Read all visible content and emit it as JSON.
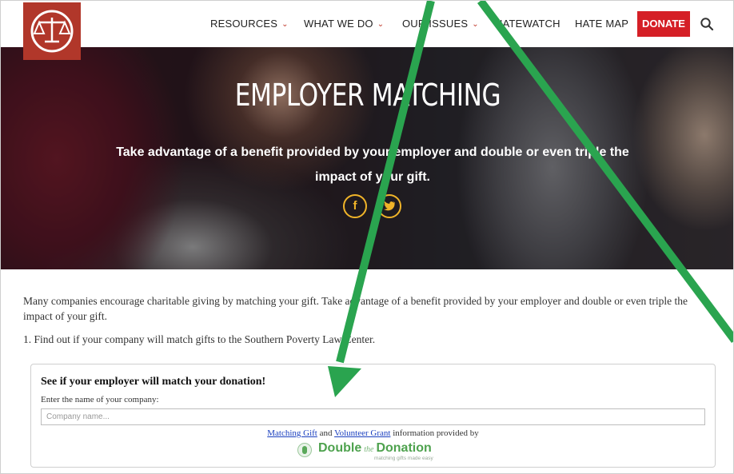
{
  "header": {
    "nav": [
      {
        "label": "RESOURCES",
        "has_dropdown": true
      },
      {
        "label": "WHAT WE DO",
        "has_dropdown": true
      },
      {
        "label": "OUR ISSUES",
        "has_dropdown": true
      },
      {
        "label": "HATEWATCH",
        "has_dropdown": false
      },
      {
        "label": "HATE MAP",
        "has_dropdown": false
      }
    ],
    "donate_label": "DONATE",
    "search_icon": "search-icon",
    "logo_icon": "scales-of-justice-icon"
  },
  "hero": {
    "title": "EMPLOYER MATCHING",
    "subtitle": "Take advantage of a benefit provided by your employer and double or even triple the impact of your gift.",
    "social": [
      {
        "icon": "facebook-icon",
        "glyph": "f"
      },
      {
        "icon": "twitter-icon",
        "glyph": "t"
      }
    ]
  },
  "content": {
    "intro": "Many companies encourage charitable giving by matching your gift. Take advantage of a benefit provided by your employer and double or even triple the impact of your gift.",
    "step_1": "1. Find out if your company will match gifts to the Southern Poverty Law Center."
  },
  "widget": {
    "title": "See if your employer will match your donation!",
    "label": "Enter the name of your company:",
    "input_placeholder": "Company name...",
    "input_value": "",
    "credit_link_1": "Matching Gift",
    "credit_and": "and",
    "credit_link_2": "Volunteer Grant",
    "credit_suffix": "information provided by",
    "brand": {
      "word1": "Double",
      "the": "the",
      "word2": "Donation",
      "tagline": "matching gifts made easy"
    }
  },
  "colors": {
    "brand_red": "#b1372a",
    "donate_red": "#d51f26",
    "social_gold": "#f0b429",
    "annotation_arrow": "#2aa44f",
    "link_blue": "#1a3fbf"
  }
}
